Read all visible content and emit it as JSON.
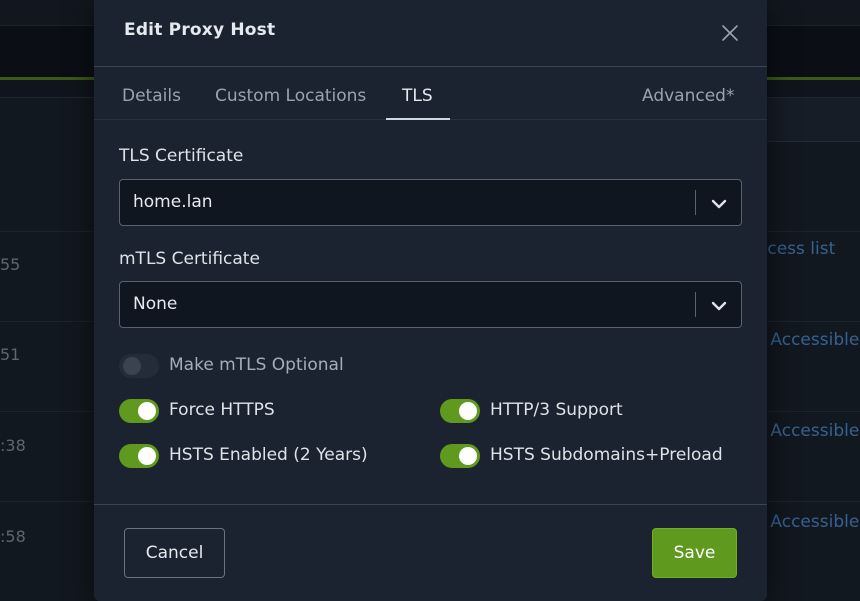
{
  "background": {
    "rows": [
      {
        "time": "55",
        "access": "ccess list"
      },
      {
        "time": "51",
        "access": "r Accessible"
      },
      {
        "time": ":38",
        "access": "r Accessible"
      },
      {
        "time": ":58",
        "access": "r Accessible"
      }
    ]
  },
  "modal": {
    "title": "Edit Proxy Host",
    "close_icon": "close-icon",
    "tabs": [
      {
        "label": "Details",
        "active": false
      },
      {
        "label": "Custom Locations",
        "active": false
      },
      {
        "label": "TLS",
        "active": true
      },
      {
        "label": "Advanced*",
        "active": false
      }
    ],
    "tls_certificate": {
      "label": "TLS Certificate",
      "value": "home.lan"
    },
    "mtls_certificate": {
      "label": "mTLS Certificate",
      "value": "None"
    },
    "toggles": {
      "mtls_optional": {
        "label": "Make mTLS Optional",
        "on": false
      },
      "force_https": {
        "label": "Force HTTPS",
        "on": true
      },
      "http3": {
        "label": "HTTP/3 Support",
        "on": true
      },
      "hsts_enabled": {
        "label": "HSTS Enabled (2 Years)",
        "on": true
      },
      "hsts_subdomains": {
        "label": "HSTS Subdomains+Preload",
        "on": true
      }
    },
    "footer": {
      "cancel_label": "Cancel",
      "save_label": "Save"
    }
  },
  "colors": {
    "accent": "#5f9a1f",
    "modal_bg": "#1b2330",
    "link": "#36628f"
  }
}
